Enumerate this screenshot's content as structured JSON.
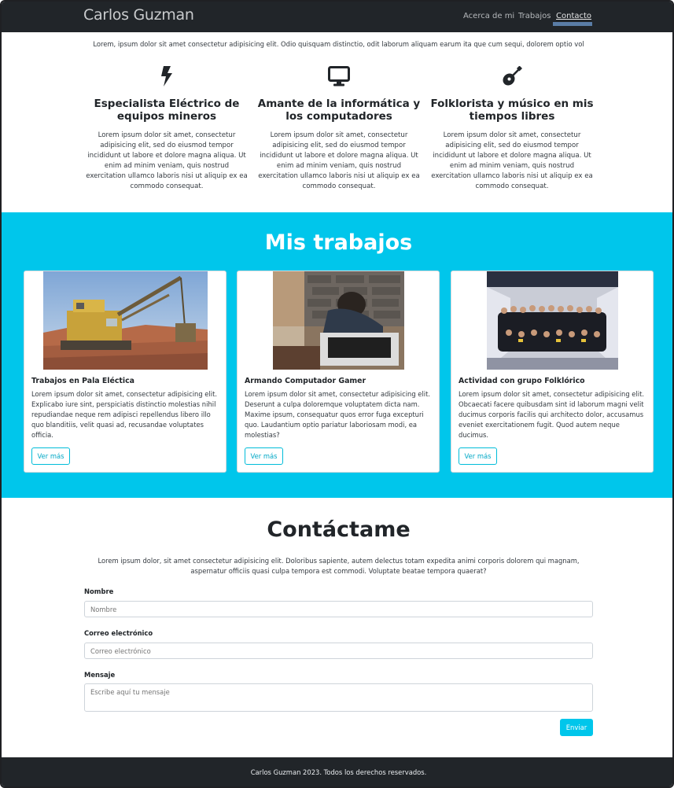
{
  "nav": {
    "brand": "Carlos Guzman",
    "links": [
      "Acerca de mi",
      "Trabajos",
      "Contacto"
    ]
  },
  "intro": "Lorem, ipsum dolor sit amet consectetur adipisicing elit. Odio quisquam distinctio, odit laborum aliquam earum ita que cum sequi, dolorem optio vol",
  "about": [
    {
      "icon": "bolt-icon",
      "title": "Especialista Eléctrico de equipos mineros",
      "text": "Lorem ipsum dolor sit amet, consectetur adipisicing elit, sed do eiusmod tempor incididunt ut labore et dolore magna aliqua. Ut enim ad minim veniam, quis nostrud exercitation ullamco laboris nisi ut aliquip ex ea commodo consequat."
    },
    {
      "icon": "desktop-icon",
      "title": "Amante de la informática y los computadores",
      "text": "Lorem ipsum dolor sit amet, consectetur adipisicing elit, sed do eiusmod tempor incididunt ut labore et dolore magna aliqua. Ut enim ad minim veniam, quis nostrud exercitation ullamco laboris nisi ut aliquip ex ea commodo consequat."
    },
    {
      "icon": "guitar-icon",
      "title": "Folklorista y músico en mis tiempos libres",
      "text": "Lorem ipsum dolor sit amet, consectetur adipisicing elit, sed do eiusmod tempor incididunt ut labore et dolore magna aliqua. Ut enim ad minim veniam, quis nostrud exercitation ullamco laboris nisi ut aliquip ex ea commodo consequat."
    }
  ],
  "works": {
    "title": "Mis trabajos",
    "cards": [
      {
        "title": "Trabajos en Pala Eléctica",
        "text": "Lorem ipsum dolor sit amet, consectetur adipisicing elit. Explicabo iure sint, perspiciatis distinctio molestias nihil repudiandae neque rem adipisci repellendus libero illo quo blanditiis, velit quasi ad, recusandae voluptates officia.",
        "button": "Ver más"
      },
      {
        "title": "Armando Computador Gamer",
        "text": "Lorem ipsum dolor sit amet, consectetur adipisicing elit. Deserunt a culpa doloremque voluptatem dicta nam. Maxime ipsum, consequatur quos error fuga excepturi quo. Laudantium optio pariatur laboriosam modi, ea molestias?",
        "button": "Ver más"
      },
      {
        "title": "Actividad con grupo Folklórico",
        "text": "Lorem ipsum dolor sit amet, consectetur adipisicing elit. Obcaecati facere quibusdam sint id laborum magni velit ducimus corporis facilis qui architecto dolor, accusamus eveniet exercitationem fugit. Quod autem neque ducimus.",
        "button": "Ver más"
      }
    ]
  },
  "contact": {
    "title": "Contáctame",
    "text": "Lorem ipsum dolor, sit amet consectetur adipisicing elit. Doloribus sapiente, autem delectus totam expedita animi corporis dolorem qui magnam, aspernatur officiis quasi culpa tempora est commodi. Voluptate beatae tempora quaerat?",
    "name_label": "Nombre",
    "name_placeholder": "Nombre",
    "email_label": "Correo electrónico",
    "email_placeholder": "Correo electrónico",
    "message_label": "Mensaje",
    "message_placeholder": "Escribe aquí tu mensaje",
    "send": "Enviar"
  },
  "footer": "Carlos Guzman 2023. Todos los derechos reservados.",
  "colors": {
    "navbar": "#212529",
    "accent": "#00c6eb",
    "footer": "#212529"
  }
}
